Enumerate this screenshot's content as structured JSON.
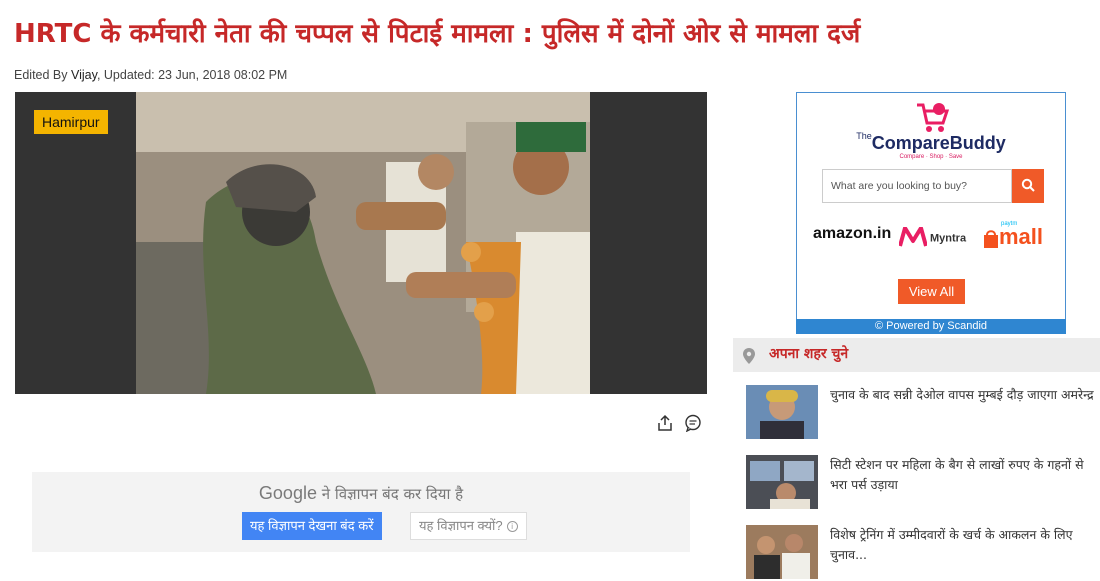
{
  "article": {
    "headline": "HRTC के कर्मचारी नेता की चप्पल से पिटाई मामला : पुलिस में दोनों ओर से मामला दर्ज",
    "byline_prefix": "Edited By ",
    "author": "Vijay",
    "updated": ", Updated: 23 Jun, 2018 08:02 PM",
    "city_tag": "Hamirpur"
  },
  "tools": {
    "share_icon": "share-icon",
    "comment_icon": "comment-icon"
  },
  "google_ad": {
    "brand": "Google",
    "message": " ने विज्ञापन बंद कर दिया है",
    "stop_label": "यह विज्ञापन देखना बंद करें",
    "why_label": "यह विज्ञापन क्यों?"
  },
  "compare_buddy": {
    "the": "The",
    "brand": "CompareBuddy",
    "tagline": "Compare · Shop · Save",
    "search_placeholder": "What are you looking to buy?",
    "stores": {
      "amazon": "amazon.in",
      "myntra": "Myntra",
      "paytm": "paytm",
      "mall": "mall"
    },
    "view_all": "View All",
    "powered": "© Powered by Scandid",
    "accent": "#f05a28"
  },
  "sidebar": {
    "city_label": "अपना शहर चुने",
    "news": [
      {
        "title": "चुनाव के बाद सन्नी देओल वापस मुम्बई दौड़ जाएगा अमरेन्द्र"
      },
      {
        "title": "सिटी स्टेशन पर महिला के बैग से लाखों रुपए के गहनों से भरा पर्स उड़ाया"
      },
      {
        "title": "विशेष ट्रेनिंग में उम्मीदवारों के खर्च के आकलन के लिए चुनाव..."
      }
    ]
  },
  "colors": {
    "headline": "#c62828",
    "tag": "#f4b400",
    "google_blue": "#4285f4"
  }
}
